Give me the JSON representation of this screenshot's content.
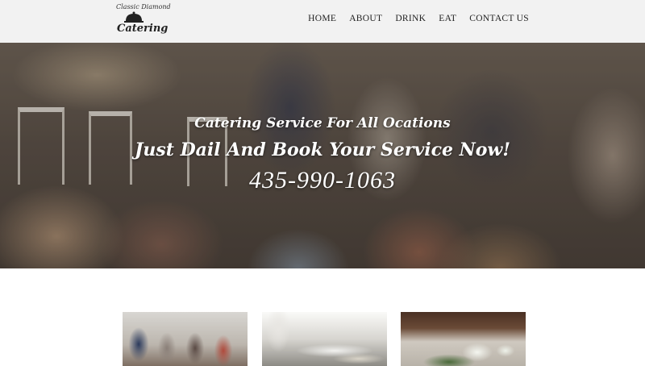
{
  "logo": {
    "tagline": "Classic Diamond",
    "brand": "Catering"
  },
  "nav": {
    "items": [
      "HOME",
      "ABOUT",
      "DRINK",
      "EAT",
      "CONTACT US"
    ]
  },
  "hero": {
    "line1": "Catering Service For All Ocations",
    "line2": "Just Dail And Book Your Service Now!",
    "phone": "435-990-1063"
  },
  "thumbnails": {
    "items": [
      "people-event-photo",
      "buffet-photo",
      "venue-photo"
    ]
  },
  "colors": {
    "header_bg": "#f2f2f2",
    "hero_text": "#ffffff",
    "nav_text": "#222222"
  }
}
